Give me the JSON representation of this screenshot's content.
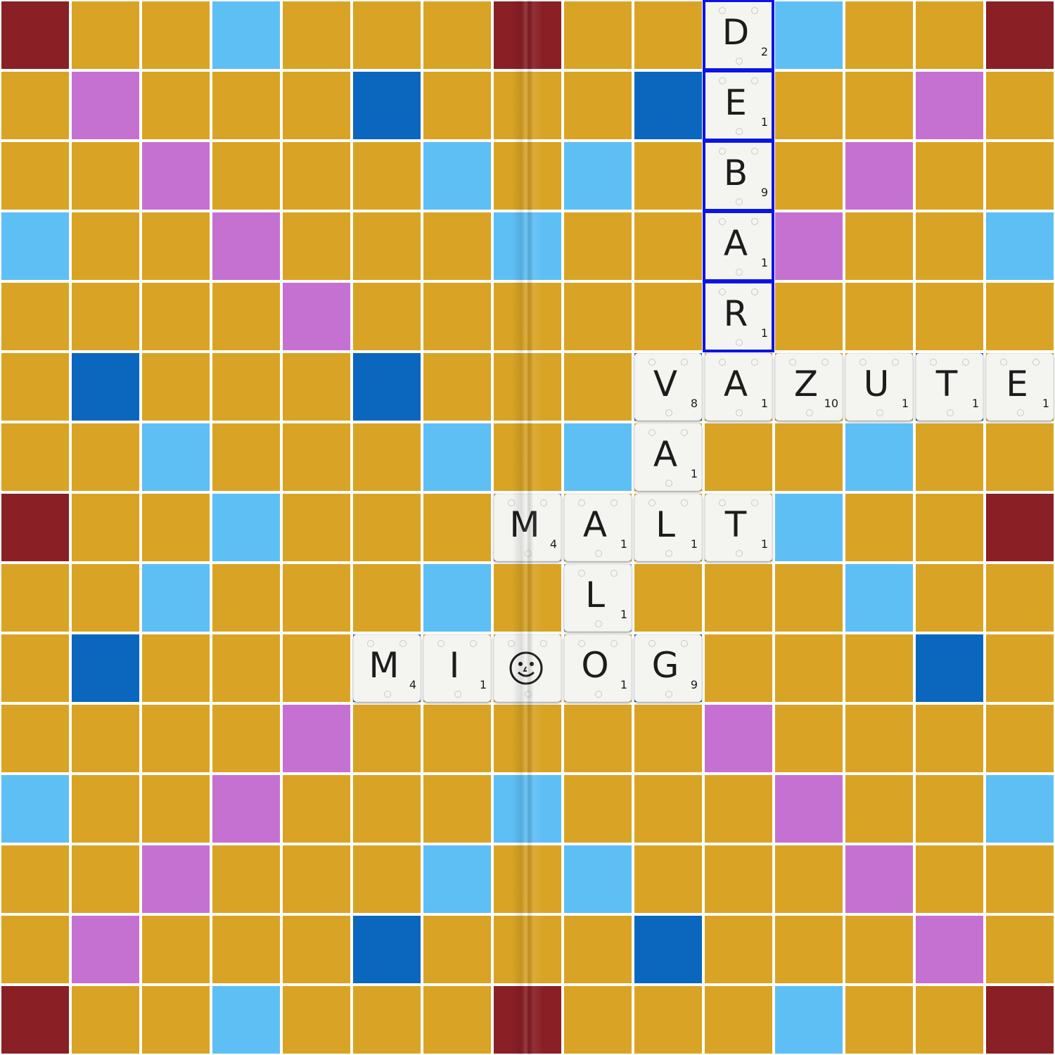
{
  "colors": {
    "normal": "#d9a425",
    "light_blue": "#5ebff5",
    "dark_blue": "#0a67bd",
    "pink": "#c571d2",
    "red": "#8a1f26",
    "grid_line": "#ffffff",
    "tile": "#f4f5f1",
    "highlight": "#0b14e6"
  },
  "board": {
    "rows": [
      [
        "rd",
        "n",
        "n",
        "lb",
        "n",
        "n",
        "n",
        "rd",
        "n",
        "n",
        "n",
        "lb",
        "n",
        "n",
        "rd"
      ],
      [
        "n",
        "pk",
        "n",
        "n",
        "n",
        "db",
        "n",
        "n",
        "n",
        "db",
        "n",
        "n",
        "n",
        "pk",
        "n"
      ],
      [
        "n",
        "n",
        "pk",
        "n",
        "n",
        "n",
        "lb",
        "n",
        "lb",
        "n",
        "n",
        "n",
        "pk",
        "n",
        "n"
      ],
      [
        "lb",
        "n",
        "n",
        "pk",
        "n",
        "n",
        "n",
        "lb",
        "n",
        "n",
        "n",
        "pk",
        "n",
        "n",
        "lb"
      ],
      [
        "n",
        "n",
        "n",
        "n",
        "pk",
        "n",
        "n",
        "n",
        "n",
        "n",
        "pk",
        "n",
        "n",
        "n",
        "n"
      ],
      [
        "n",
        "db",
        "n",
        "n",
        "n",
        "db",
        "n",
        "n",
        "n",
        "db",
        "n",
        "n",
        "n",
        "db",
        "n"
      ],
      [
        "n",
        "n",
        "lb",
        "n",
        "n",
        "n",
        "lb",
        "n",
        "lb",
        "n",
        "n",
        "n",
        "lb",
        "n",
        "n"
      ],
      [
        "rd",
        "n",
        "n",
        "lb",
        "n",
        "n",
        "n",
        "pk",
        "n",
        "n",
        "n",
        "lb",
        "n",
        "n",
        "rd"
      ],
      [
        "n",
        "n",
        "lb",
        "n",
        "n",
        "n",
        "lb",
        "n",
        "lb",
        "n",
        "n",
        "n",
        "lb",
        "n",
        "n"
      ],
      [
        "n",
        "db",
        "n",
        "n",
        "n",
        "db",
        "n",
        "n",
        "n",
        "db",
        "n",
        "n",
        "n",
        "db",
        "n"
      ],
      [
        "n",
        "n",
        "n",
        "n",
        "pk",
        "n",
        "n",
        "n",
        "n",
        "n",
        "pk",
        "n",
        "n",
        "n",
        "n"
      ],
      [
        "lb",
        "n",
        "n",
        "pk",
        "n",
        "n",
        "n",
        "lb",
        "n",
        "n",
        "n",
        "pk",
        "n",
        "n",
        "lb"
      ],
      [
        "n",
        "n",
        "pk",
        "n",
        "n",
        "n",
        "lb",
        "n",
        "lb",
        "n",
        "n",
        "n",
        "pk",
        "n",
        "n"
      ],
      [
        "n",
        "pk",
        "n",
        "n",
        "n",
        "db",
        "n",
        "n",
        "n",
        "db",
        "n",
        "n",
        "n",
        "pk",
        "n"
      ],
      [
        "rd",
        "n",
        "n",
        "lb",
        "n",
        "n",
        "n",
        "rd",
        "n",
        "n",
        "n",
        "lb",
        "n",
        "n",
        "rd"
      ]
    ]
  },
  "tiles": [
    {
      "row": 0,
      "col": 10,
      "letter": "D",
      "points": "2",
      "highlighted": true
    },
    {
      "row": 1,
      "col": 10,
      "letter": "E",
      "points": "1",
      "highlighted": true
    },
    {
      "row": 2,
      "col": 10,
      "letter": "B",
      "points": "9",
      "highlighted": true
    },
    {
      "row": 3,
      "col": 10,
      "letter": "A",
      "points": "1",
      "highlighted": true
    },
    {
      "row": 4,
      "col": 10,
      "letter": "R",
      "points": "1",
      "highlighted": true
    },
    {
      "row": 5,
      "col": 9,
      "letter": "V",
      "points": "8",
      "highlighted": false
    },
    {
      "row": 5,
      "col": 10,
      "letter": "A",
      "points": "1",
      "highlighted": false
    },
    {
      "row": 5,
      "col": 11,
      "letter": "Z",
      "points": "10",
      "highlighted": false
    },
    {
      "row": 5,
      "col": 12,
      "letter": "U",
      "points": "1",
      "highlighted": false
    },
    {
      "row": 5,
      "col": 13,
      "letter": "T",
      "points": "1",
      "highlighted": false
    },
    {
      "row": 5,
      "col": 14,
      "letter": "E",
      "points": "1",
      "highlighted": false
    },
    {
      "row": 6,
      "col": 9,
      "letter": "A",
      "points": "1",
      "highlighted": false
    },
    {
      "row": 7,
      "col": 7,
      "letter": "M",
      "points": "4",
      "highlighted": false
    },
    {
      "row": 7,
      "col": 8,
      "letter": "A",
      "points": "1",
      "highlighted": false
    },
    {
      "row": 7,
      "col": 9,
      "letter": "L",
      "points": "1",
      "highlighted": false
    },
    {
      "row": 7,
      "col": 10,
      "letter": "T",
      "points": "1",
      "highlighted": false
    },
    {
      "row": 8,
      "col": 8,
      "letter": "L",
      "points": "1",
      "highlighted": false
    },
    {
      "row": 9,
      "col": 5,
      "letter": "M",
      "points": "4",
      "highlighted": false
    },
    {
      "row": 9,
      "col": 6,
      "letter": "I",
      "points": "1",
      "highlighted": false
    },
    {
      "row": 9,
      "col": 7,
      "letter": "",
      "points": "",
      "blank": true,
      "icon": "smiley-face-icon",
      "highlighted": false
    },
    {
      "row": 9,
      "col": 8,
      "letter": "O",
      "points": "1",
      "highlighted": false
    },
    {
      "row": 9,
      "col": 9,
      "letter": "G",
      "points": "9",
      "highlighted": false
    }
  ]
}
